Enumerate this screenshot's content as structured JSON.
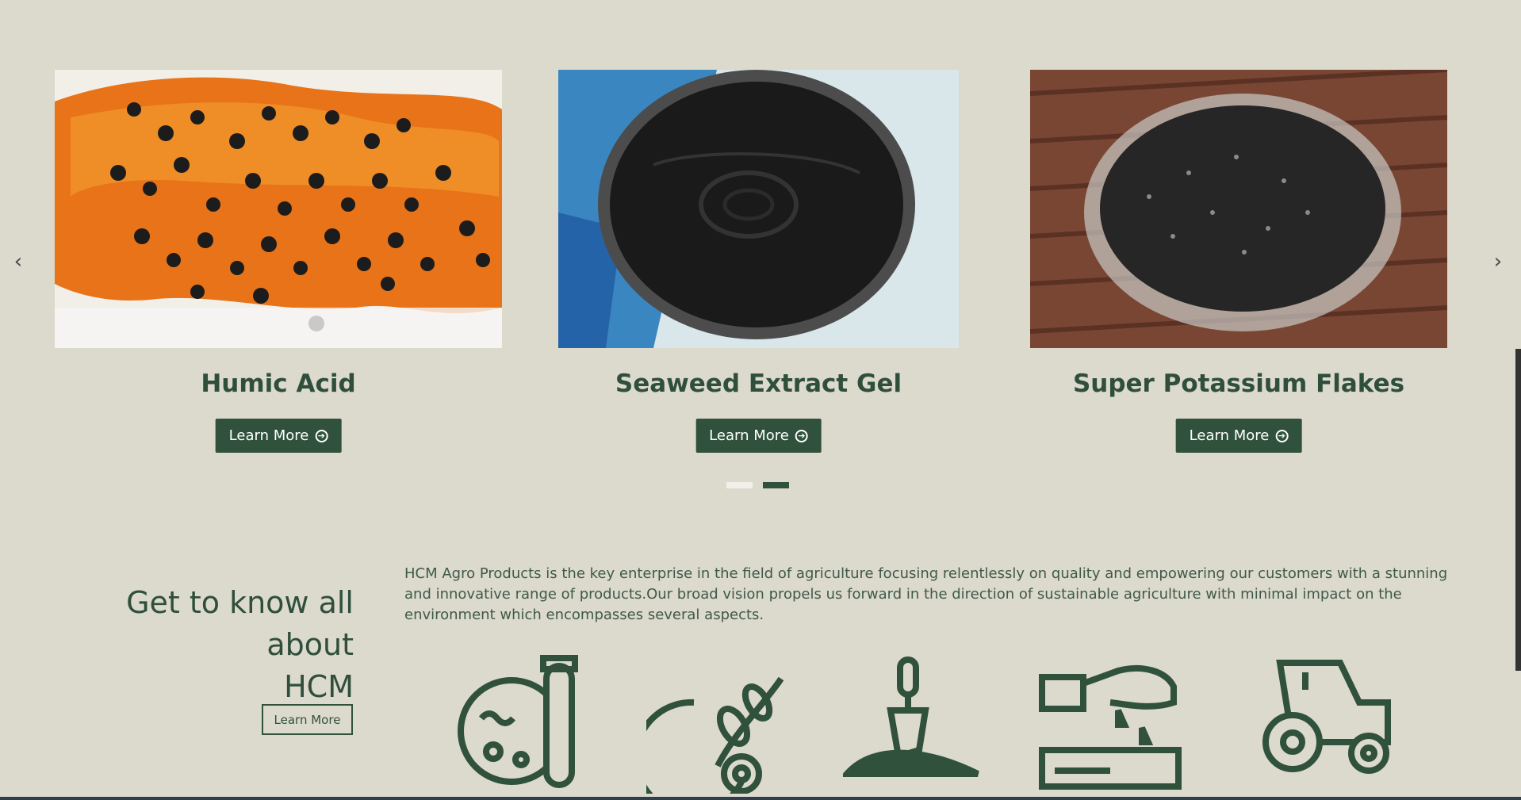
{
  "carousel": {
    "prev_icon": "chevron-left-icon",
    "next_icon": "chevron-right-icon",
    "products": [
      {
        "title": "Humic Acid",
        "button_label": "Learn More",
        "image": "black-spheres-on-orange-gel"
      },
      {
        "title": "Seaweed Extract Gel",
        "button_label": "Learn More",
        "image": "black-gel-in-bowl"
      },
      {
        "title": "Super Potassium Flakes",
        "button_label": "Learn More",
        "image": "dark-flakes-in-glass-dish"
      }
    ],
    "pagination": {
      "pages": 2,
      "active": 2
    }
  },
  "about": {
    "heading_line1": "Get to know all about",
    "heading_line2": "HCM",
    "button_label": "Learn More",
    "description": "HCM Agro Products is the key enterprise in the field of agriculture focusing relentlessly on quality and empowering our customers with a stunning and innovative range of products.Our broad vision propels us forward in the direction of sustainable agriculture with minimal impact on the environment which encompasses several aspects.",
    "icons": [
      "petri-dish-test-tube-icon",
      "wheat-gear-icon",
      "trowel-soil-icon",
      "hand-fertilizer-icon",
      "tractor-icon"
    ]
  },
  "colors": {
    "background": "#dcd9cd",
    "primary": "#30513b",
    "text": "#2f4f3c"
  }
}
